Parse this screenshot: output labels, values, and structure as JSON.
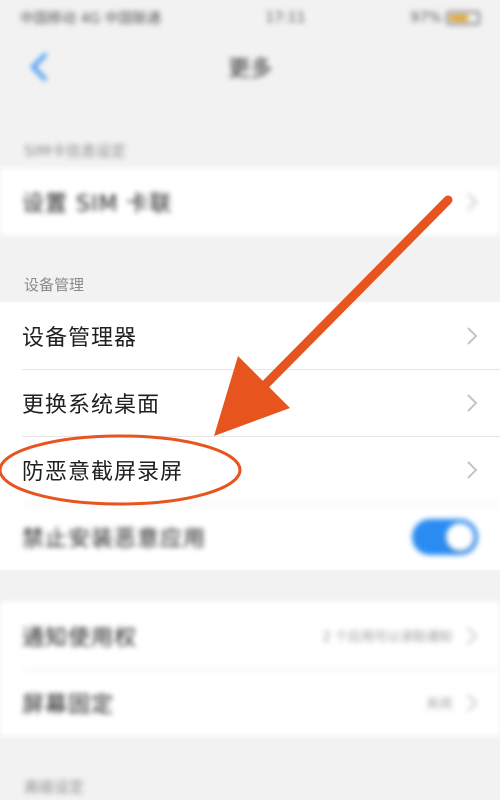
{
  "status_bar": {
    "carrier": "中国移动 4G 中国联通",
    "time": "17:11",
    "battery": "97%"
  },
  "header": {
    "title": "更多"
  },
  "sim_section": {
    "label": "SIM卡信息设定",
    "row_label": "设置 SIM 卡联"
  },
  "device_section": {
    "label": "设备管理",
    "items": [
      {
        "label": "设备管理器"
      },
      {
        "label": "更换系统桌面"
      },
      {
        "label": "防恶意截屏录屏"
      },
      {
        "label": "禁止安装恶意应用",
        "toggle_on": true
      }
    ]
  },
  "other_section": {
    "items": [
      {
        "label": "通知使用权",
        "value": "2 个应用可以读取通知"
      },
      {
        "label": "屏幕固定",
        "value": "关闭"
      }
    ]
  },
  "bottom_section": {
    "label": "高级设定"
  },
  "colors": {
    "toggle_on": "#2a8cf2",
    "annotation": "#e8541e",
    "back_icon": "#2a8cf2"
  }
}
